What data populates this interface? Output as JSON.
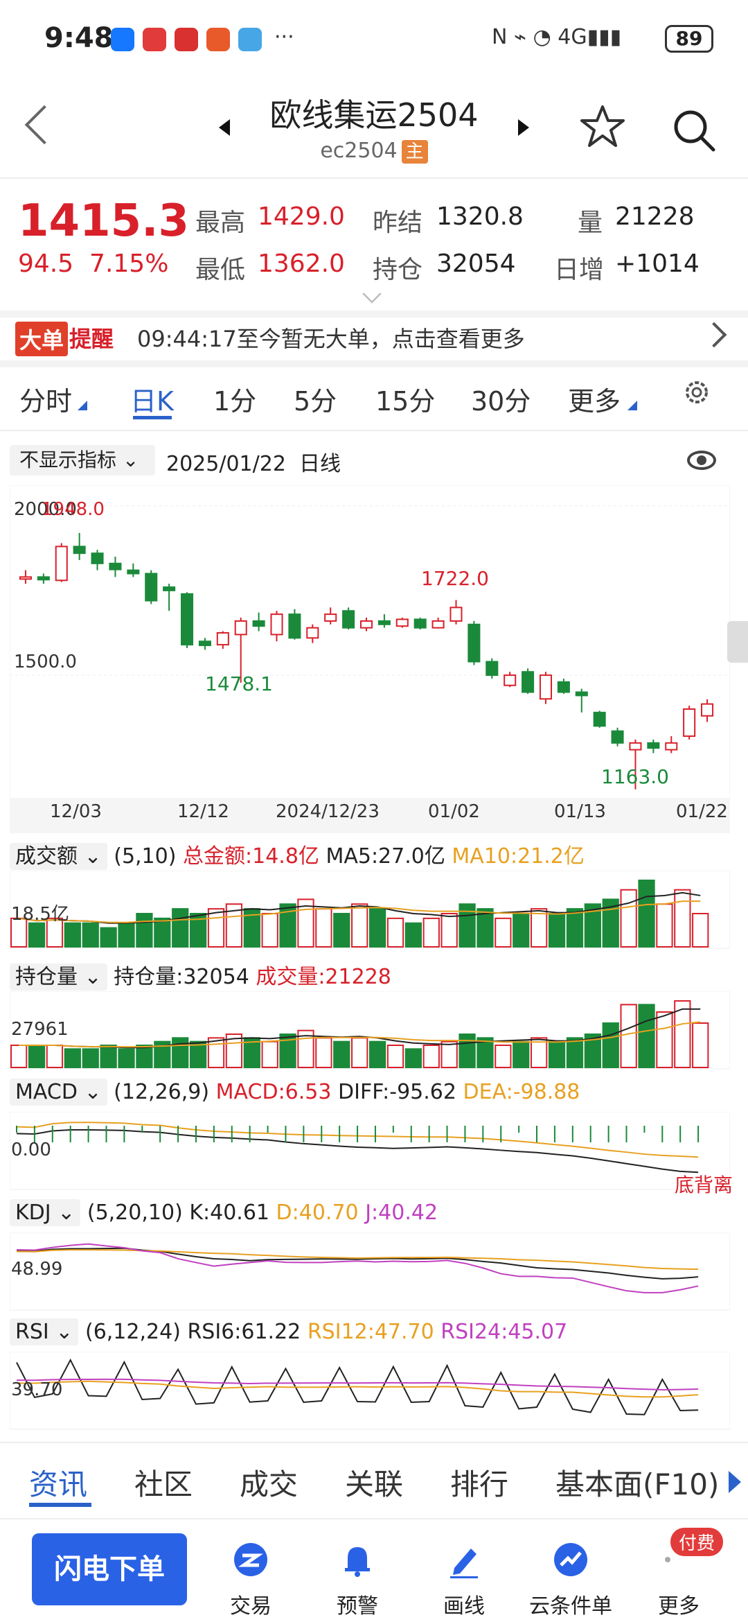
{
  "status": {
    "time": "9:48",
    "battery": "89"
  },
  "header": {
    "title": "欧线集运2504",
    "code": "ec2504",
    "main_badge": "主"
  },
  "quote": {
    "price": "1415.3",
    "change": "94.5",
    "change_pct": "7.15%",
    "high_label": "最高",
    "high": "1429.0",
    "low_label": "最低",
    "low": "1362.0",
    "prev_settle_label": "昨结",
    "prev_settle": "1320.8",
    "oi_label": "持仓",
    "oi": "32054",
    "volume_label": "量",
    "volume": "21228",
    "daily_inc_label": "日增",
    "daily_inc": "+1014"
  },
  "alert": {
    "badge_a": "大单",
    "badge_b": "提醒",
    "text": "09:44:17至今暂无大单，点击查看更多"
  },
  "tabs": [
    "分时",
    "日K",
    "1分",
    "5分",
    "15分",
    "30分",
    "更多"
  ],
  "indicator_bar": {
    "selector": "不显示指标",
    "date": "2025/01/22",
    "period": "日线"
  },
  "kline": {
    "top_label": "2000.0",
    "top_mark": "1948.0",
    "mid_label": "1500.0",
    "marks": {
      "high_mid": "1722.0",
      "low1": "1478.1",
      "low2": "1163.0"
    },
    "xticks": [
      "12/03",
      "12/12",
      "2024/12/23",
      "01/02",
      "01/13",
      "01/22"
    ]
  },
  "vol_panel": {
    "name": "成交额",
    "params": "(5,10)",
    "total": "总金额:14.8亿",
    "ma5": "MA5:27.0亿",
    "ma10": "MA10:21.2亿",
    "axis": "18.5亿"
  },
  "oi_panel": {
    "name": "持仓量",
    "oi": "持仓量:32054",
    "vol": "成交量:21228",
    "axis": "27961"
  },
  "macd_panel": {
    "name": "MACD",
    "params": "(12,26,9)",
    "macd": "MACD:6.53",
    "diff": "DIFF:-95.62",
    "dea": "DEA:-98.88",
    "axis": "0.00",
    "note": "底背离"
  },
  "kdj_panel": {
    "name": "KDJ",
    "params": "(5,20,10)",
    "k": "K:40.61",
    "d": "D:40.70",
    "j": "J:40.42",
    "axis": "48.99"
  },
  "rsi_panel": {
    "name": "RSI",
    "params": "(6,12,24)",
    "rsi6": "RSI6:61.22",
    "rsi12": "RSI12:47.70",
    "rsi24": "RSI24:45.07",
    "axis": "39.70"
  },
  "bottom_tabs": [
    "资讯",
    "社区",
    "成交",
    "关联",
    "排行",
    "基本面(F10)"
  ],
  "actions": {
    "flash": "闪电下单",
    "trade": "交易",
    "alert": "预警",
    "draw": "画线",
    "cloud": "云条件单",
    "more": "更多",
    "paid": "付费"
  },
  "colors": {
    "up": "#d8202a",
    "down": "#1a8a3a",
    "accent": "#2a62c9",
    "ma10": "#e8a020",
    "kdj_j": "#c040c0"
  },
  "chart_data": {
    "type": "candlestick",
    "candles": [
      {
        "o": 1790,
        "c": 1790,
        "h": 1810,
        "l": 1770
      },
      {
        "o": 1790,
        "c": 1782,
        "h": 1800,
        "l": 1770
      },
      {
        "o": 1780,
        "c": 1880,
        "h": 1890,
        "l": 1775
      },
      {
        "o": 1880,
        "c": 1860,
        "h": 1920,
        "l": 1840
      },
      {
        "o": 1860,
        "c": 1830,
        "h": 1870,
        "l": 1810
      },
      {
        "o": 1830,
        "c": 1812,
        "h": 1850,
        "l": 1790
      },
      {
        "o": 1810,
        "c": 1800,
        "h": 1830,
        "l": 1790
      },
      {
        "o": 1800,
        "c": 1720,
        "h": 1810,
        "l": 1710
      },
      {
        "o": 1760,
        "c": 1750,
        "h": 1770,
        "l": 1690
      },
      {
        "o": 1740,
        "c": 1590,
        "h": 1745,
        "l": 1580
      },
      {
        "o": 1600,
        "c": 1588,
        "h": 1610,
        "l": 1575
      },
      {
        "o": 1590,
        "c": 1625,
        "h": 1630,
        "l": 1578
      },
      {
        "o": 1620,
        "c": 1660,
        "h": 1670,
        "l": 1478
      },
      {
        "o": 1660,
        "c": 1645,
        "h": 1685,
        "l": 1630
      },
      {
        "o": 1620,
        "c": 1680,
        "h": 1690,
        "l": 1600
      },
      {
        "o": 1680,
        "c": 1610,
        "h": 1695,
        "l": 1605
      },
      {
        "o": 1610,
        "c": 1640,
        "h": 1650,
        "l": 1595
      },
      {
        "o": 1660,
        "c": 1680,
        "h": 1700,
        "l": 1650
      },
      {
        "o": 1690,
        "c": 1640,
        "h": 1700,
        "l": 1635
      },
      {
        "o": 1640,
        "c": 1660,
        "h": 1670,
        "l": 1630
      },
      {
        "o": 1660,
        "c": 1650,
        "h": 1680,
        "l": 1640
      },
      {
        "o": 1645,
        "c": 1665,
        "h": 1670,
        "l": 1640
      },
      {
        "o": 1665,
        "c": 1640,
        "h": 1670,
        "l": 1635
      },
      {
        "o": 1640,
        "c": 1660,
        "h": 1670,
        "l": 1638
      },
      {
        "o": 1660,
        "c": 1700,
        "h": 1722,
        "l": 1650
      },
      {
        "o": 1650,
        "c": 1540,
        "h": 1660,
        "l": 1530
      },
      {
        "o": 1540,
        "c": 1500,
        "h": 1550,
        "l": 1490
      },
      {
        "o": 1470,
        "c": 1500,
        "h": 1510,
        "l": 1465
      },
      {
        "o": 1510,
        "c": 1450,
        "h": 1520,
        "l": 1445
      },
      {
        "o": 1430,
        "c": 1500,
        "h": 1510,
        "l": 1415
      },
      {
        "o": 1480,
        "c": 1450,
        "h": 1490,
        "l": 1445
      },
      {
        "o": 1450,
        "c": 1440,
        "h": 1460,
        "l": 1390
      },
      {
        "o": 1390,
        "c": 1350,
        "h": 1395,
        "l": 1345
      },
      {
        "o": 1335,
        "c": 1300,
        "h": 1345,
        "l": 1290
      },
      {
        "o": 1280,
        "c": 1300,
        "h": 1310,
        "l": 1163
      },
      {
        "o": 1300,
        "c": 1285,
        "h": 1310,
        "l": 1270
      },
      {
        "o": 1280,
        "c": 1300,
        "h": 1320,
        "l": 1270
      },
      {
        "o": 1320,
        "c": 1400,
        "h": 1410,
        "l": 1310
      },
      {
        "o": 1380,
        "c": 1415,
        "h": 1429,
        "l": 1362
      }
    ],
    "volume": [
      6,
      5,
      6,
      5,
      5,
      4,
      5,
      7,
      6,
      8,
      7,
      8,
      9,
      8,
      7,
      9,
      10,
      8,
      7,
      9,
      8,
      6,
      5,
      6,
      7,
      9,
      8,
      6,
      7,
      8,
      7,
      8,
      9,
      10,
      12,
      14,
      9,
      12,
      7
    ],
    "oi": [
      6,
      6,
      6,
      5,
      5,
      6,
      5,
      6,
      7,
      8,
      7,
      8,
      9,
      8,
      7,
      9,
      10,
      8,
      7,
      8,
      7,
      6,
      5,
      6,
      7,
      9,
      8,
      6,
      7,
      8,
      7,
      8,
      9,
      12,
      17,
      17,
      15,
      18,
      12
    ]
  }
}
